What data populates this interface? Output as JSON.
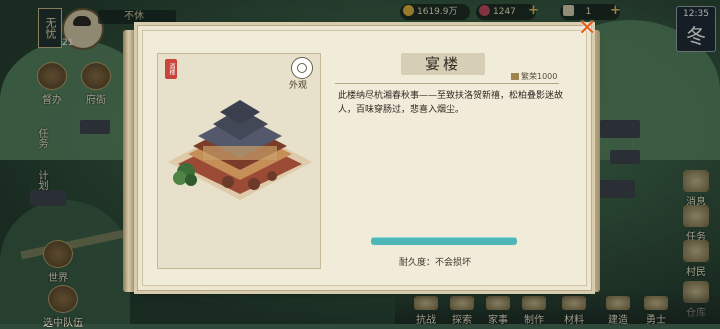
{
  "player": {
    "emblem_text": "无忧",
    "level": "21",
    "name": "不休"
  },
  "left_menu": {
    "items": [
      {
        "label": "督办"
      },
      {
        "label": "府衙"
      },
      {
        "label": "世界"
      },
      {
        "label": "选中队伍"
      }
    ],
    "vertical_tabs": [
      {
        "label": "任务"
      },
      {
        "label": "计划"
      }
    ]
  },
  "resources": {
    "gold": "1619.9万",
    "gem": "1247",
    "ticket": "1"
  },
  "season": {
    "time": "12:35",
    "name": "冬"
  },
  "right_menu": {
    "items": [
      {
        "label": "消息"
      },
      {
        "label": "任务"
      },
      {
        "label": "村民"
      },
      {
        "label": "仓库"
      }
    ]
  },
  "bottom_bar": {
    "items": [
      {
        "label": "抗战"
      },
      {
        "label": "探索"
      },
      {
        "label": "家事"
      },
      {
        "label": "制作"
      },
      {
        "label": "材料"
      },
      {
        "label": "建造"
      },
      {
        "label": "勇士"
      }
    ]
  },
  "dialog": {
    "tag_text": "酒楼",
    "look_label": "外观",
    "title": "宴楼",
    "prosperity": "繁荣1000",
    "description": "此楼纳尽杭湘春秋事——至致扶洛贺新禧，松柏叠影迷故人，百味穿肠过，悲喜入烟尘。",
    "durability_label": "耐久度：不会损坏",
    "durability_fill": 1.0,
    "colors": {
      "bar": "#4fb6b8",
      "close": "#e2611e",
      "tag": "#c9453a"
    }
  }
}
